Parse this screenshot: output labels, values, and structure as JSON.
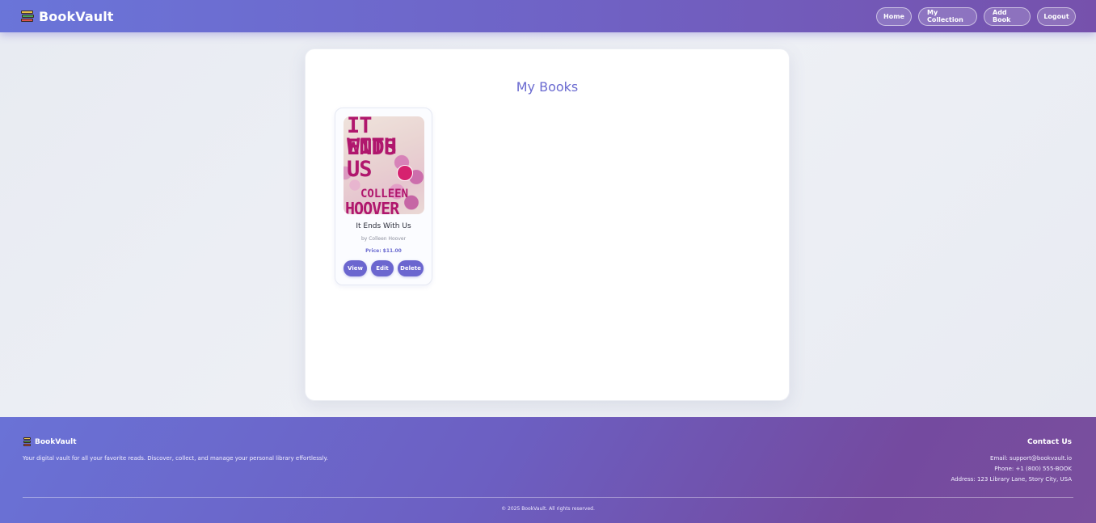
{
  "navbar": {
    "brand": "BookVault",
    "links": [
      "Home",
      "My Collection",
      "Add Book",
      "Logout"
    ]
  },
  "main": {
    "title": "My Books",
    "books": [
      {
        "title": "It Ends With Us",
        "author": "by Colleen Hoover",
        "price": "Price: $11.00",
        "cover_text": [
          "IT ENDS",
          "WITH",
          "US",
          "COLLEEN",
          "HOOVER"
        ],
        "actions": [
          "View",
          "Edit",
          "Delete"
        ]
      }
    ]
  },
  "footer": {
    "brand": "BookVault",
    "tagline": "Your digital vault for all your favorite reads. Discover, collect, and manage your personal library effortlessly.",
    "contact_title": "Contact Us",
    "email": "Email: support@bookvault.io",
    "phone": "Phone: +1 (800) 555-BOOK",
    "address": "Address: 123 Library Lane, Story City, USA",
    "copyright": "© 2025 BookVault. All rights reserved."
  },
  "colors": {
    "accent": "#6b66cf",
    "nav_gradient_start": "#6a75d9",
    "nav_gradient_end": "#7651ac"
  }
}
